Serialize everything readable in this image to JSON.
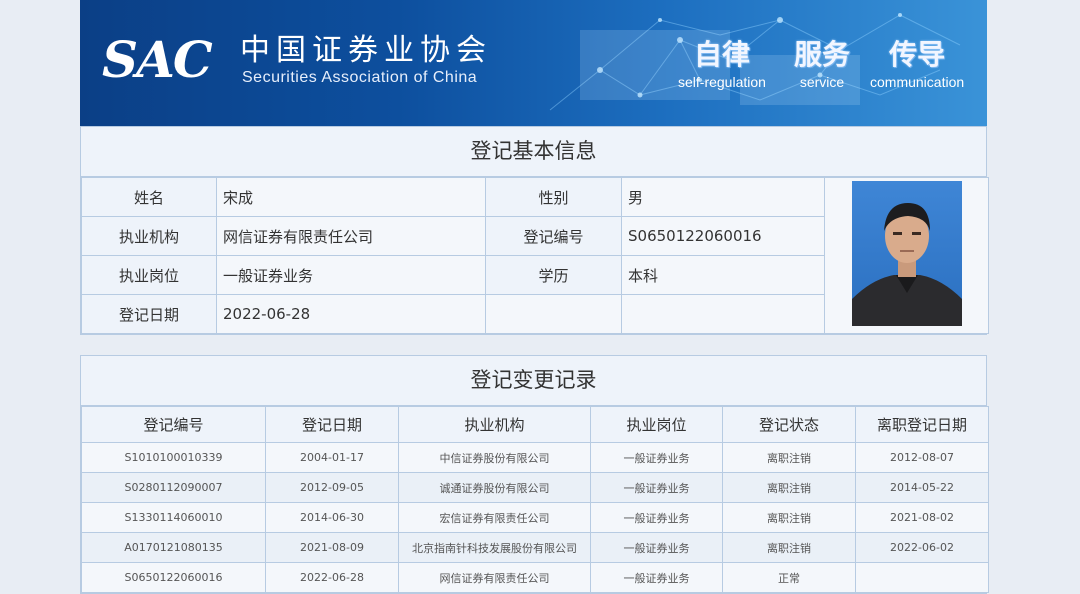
{
  "header": {
    "logo_text": "SAC",
    "org_name_cn": "中国证券业协会",
    "org_name_en": "Securities Association of China",
    "motto": [
      {
        "cn": "自律",
        "en": "self-regulation"
      },
      {
        "cn": "服务",
        "en": "service"
      },
      {
        "cn": "传导",
        "en": "communication"
      }
    ]
  },
  "basic_info": {
    "title": "登记基本信息",
    "name_label": "姓名",
    "name": "宋成",
    "gender_label": "性别",
    "gender": "男",
    "institution_label": "执业机构",
    "institution": "网信证券有限责任公司",
    "reg_no_label": "登记编号",
    "reg_no": "S0650122060016",
    "position_label": "执业岗位",
    "position": "一般证券业务",
    "education_label": "学历",
    "education": "本科",
    "reg_date_label": "登记日期",
    "reg_date": "2022-06-28"
  },
  "change_records": {
    "title": "登记变更记录",
    "columns": [
      "登记编号",
      "登记日期",
      "执业机构",
      "执业岗位",
      "登记状态",
      "离职登记日期"
    ],
    "rows": [
      [
        "S1010100010339",
        "2004-01-17",
        "中信证券股份有限公司",
        "一般证券业务",
        "离职注销",
        "2012-08-07"
      ],
      [
        "S0280112090007",
        "2012-09-05",
        "诚通证券股份有限公司",
        "一般证券业务",
        "离职注销",
        "2014-05-22"
      ],
      [
        "S1330114060010",
        "2014-06-30",
        "宏信证券有限责任公司",
        "一般证券业务",
        "离职注销",
        "2021-08-02"
      ],
      [
        "A0170121080135",
        "2021-08-09",
        "北京指南针科技发展股份有限公司",
        "一般证券业务",
        "离职注销",
        "2022-06-02"
      ],
      [
        "S0650122060016",
        "2022-06-28",
        "网信证券有限责任公司",
        "一般证券业务",
        "正常",
        ""
      ]
    ]
  }
}
